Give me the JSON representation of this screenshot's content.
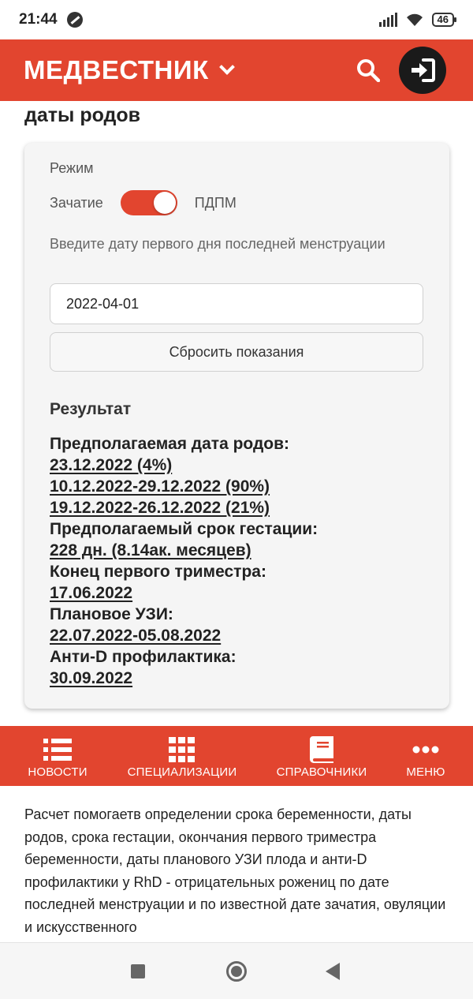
{
  "status_bar": {
    "time": "21:44",
    "battery": "46"
  },
  "header": {
    "logo": "МЕДВЕСТНИК"
  },
  "page": {
    "heading": "даты родов"
  },
  "calculator": {
    "mode_label": "Режим",
    "toggle_left": "Зачатие",
    "toggle_right": "ПДПМ",
    "toggle_on": true,
    "date_label": "Введите дату первого дня последней менструации",
    "date_value": "2022-04-01",
    "reset_label": "Сбросить показания",
    "result_title": "Результат",
    "results": [
      {
        "label": "Предполагаемая дата родов:",
        "values": [
          "23.12.2022 (4%)",
          "10.12.2022-29.12.2022 (90%)",
          "19.12.2022-26.12.2022 (21%)"
        ]
      },
      {
        "label": "Предполагаемый срок гестации:",
        "values": [
          "228 дн. (8.14ак. месяцев)"
        ]
      },
      {
        "label": "Конец первого триместра:",
        "values": [
          "17.06.2022"
        ]
      },
      {
        "label": "Плановое УЗИ:",
        "values": [
          "22.07.2022-05.08.2022"
        ]
      },
      {
        "label": "Анти-D профилактика:",
        "values": [
          "30.09.2022"
        ]
      }
    ]
  },
  "bottom_nav": {
    "items": [
      {
        "label": "НОВОСТИ",
        "icon": "list-icon"
      },
      {
        "label": "СПЕЦИАЛИЗАЦИИ",
        "icon": "grid-icon"
      },
      {
        "label": "СПРАВОЧНИКИ",
        "icon": "book-icon"
      },
      {
        "label": "МЕНЮ",
        "icon": "more-icon"
      }
    ]
  },
  "description": "Расчет помогаетв  определении срока беременности, даты родов, срока гестации, окончания первого триместра беременности, даты планового УЗИ плода и анти-D профилактики у RhD - отрицательных рожениц по дате последней менструации и по известной дате зачатия, овуляции и искусственного",
  "colors": {
    "brand": "#e2452f",
    "login_bg": "#1a1a1a"
  }
}
